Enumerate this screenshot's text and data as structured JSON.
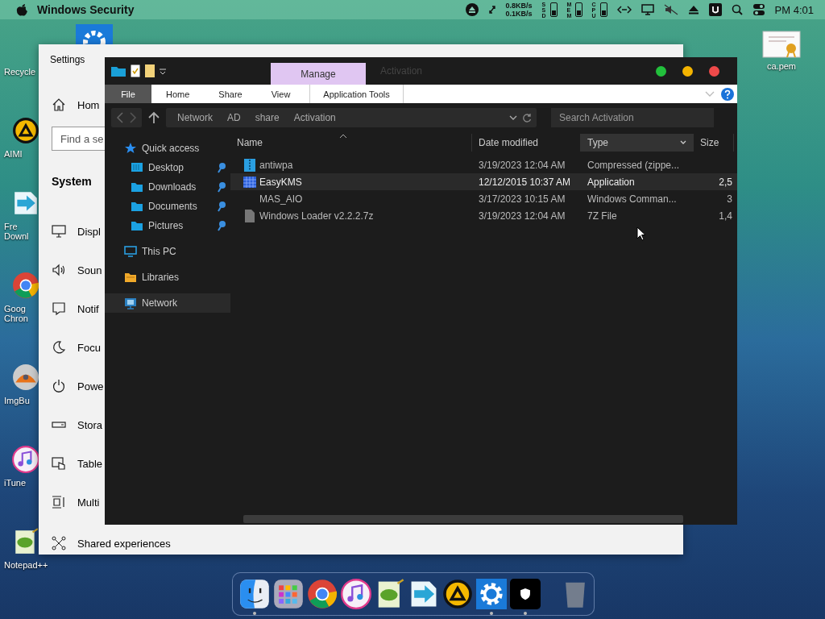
{
  "menu_bar": {
    "app_name": "Windows Security",
    "net_up": "0.8KB/s",
    "net_down": "0.1KB/s",
    "meters": [
      {
        "label": "SSD"
      },
      {
        "label": "MEM"
      },
      {
        "label": "CPU"
      }
    ],
    "clock": "PM 4:01"
  },
  "desktop_icons": [
    {
      "kind": "recycle",
      "lines": [
        "Recycle"
      ]
    },
    {
      "kind": "aimp",
      "lines": [
        "AIMI"
      ]
    },
    {
      "kind": "download",
      "lines": [
        "Fre",
        "Downl"
      ]
    },
    {
      "kind": "chrome",
      "lines": [
        "Goog",
        "Chron"
      ]
    },
    {
      "kind": "disc",
      "lines": [
        "ImgBu"
      ]
    },
    {
      "kind": "music",
      "lines": [
        "iTune"
      ]
    },
    {
      "kind": "notepad",
      "lines": [
        "Notepad++"
      ]
    }
  ],
  "right_icon": {
    "label": "ca.pem"
  },
  "settings": {
    "title": "Settings",
    "home": "Hom",
    "search_placeholder": "Find a se",
    "section": "System",
    "items": [
      {
        "kind": "display",
        "label": "Displ"
      },
      {
        "kind": "sound",
        "label": "Soun"
      },
      {
        "kind": "notify",
        "label": "Notif"
      },
      {
        "kind": "focus",
        "label": "Focu"
      },
      {
        "kind": "power",
        "label": "Powe"
      },
      {
        "kind": "storage",
        "label": "Stora"
      },
      {
        "kind": "tablet",
        "label": "Table"
      },
      {
        "kind": "multi",
        "label": "Multi"
      },
      {
        "kind": "shared",
        "label": "Shared experiences"
      }
    ]
  },
  "explorer": {
    "title": "Activation",
    "context_group": "Manage",
    "ribbon_tabs": [
      {
        "kind": "file",
        "label": "File"
      },
      {
        "kind": "tab",
        "label": "Home"
      },
      {
        "kind": "tab",
        "label": "Share"
      },
      {
        "kind": "tab",
        "label": "View"
      },
      {
        "kind": "context",
        "label": "Application Tools"
      }
    ],
    "breadcrumbs": [
      "Network",
      "AD",
      "share",
      "Activation"
    ],
    "search_placeholder": "Search Activation",
    "nav": [
      {
        "kind": "star",
        "label": "Quick access",
        "pinned": false,
        "selected": false,
        "children": [
          {
            "kind": "desktop",
            "label": "Desktop",
            "pinned": true,
            "selected": false
          },
          {
            "kind": "download",
            "label": "Downloads",
            "pinned": true,
            "selected": false
          },
          {
            "kind": "folder",
            "label": "Documents",
            "pinned": true,
            "selected": false
          },
          {
            "kind": "folder",
            "label": "Pictures",
            "pinned": true,
            "selected": false
          }
        ]
      },
      {
        "kind": "pc",
        "label": "This PC",
        "pinned": false,
        "selected": false
      },
      {
        "kind": "library",
        "label": "Libraries",
        "pinned": false,
        "selected": false
      },
      {
        "kind": "network",
        "label": "Network",
        "pinned": false,
        "selected": true
      }
    ],
    "columns": [
      {
        "label": "Name",
        "sorted": true,
        "highlighted": false
      },
      {
        "label": "Date modified",
        "sorted": false,
        "highlighted": false
      },
      {
        "label": "Type",
        "sorted": false,
        "highlighted": true
      },
      {
        "label": "Size",
        "sorted": false,
        "highlighted": false
      }
    ],
    "rows": [
      {
        "kind": "zip",
        "name": "antiwpa",
        "date": "3/19/2023 12:04 AM",
        "type": "Compressed (zippe...",
        "selected": false
      },
      {
        "kind": "app",
        "name": "EasyKMS",
        "date": "12/12/2015 10:37 AM",
        "type": "Application",
        "size": "2,5",
        "selected": true
      },
      {
        "kind": "none",
        "name": "MAS_AIO",
        "date": "3/17/2023 10:15 AM",
        "type": "Windows Comman...",
        "size": "3",
        "selected": false
      },
      {
        "kind": "file",
        "name": "Windows Loader v2.2.2.7z",
        "date": "3/19/2023 12:04 AM",
        "type": "7Z File",
        "size": "1,4",
        "selected": false
      }
    ]
  },
  "dock": [
    {
      "kind": "finder",
      "running": true
    },
    {
      "kind": "launchpad",
      "running": false
    },
    {
      "kind": "chrome",
      "running": false
    },
    {
      "kind": "music",
      "running": false
    },
    {
      "kind": "notepad",
      "running": false
    },
    {
      "kind": "download",
      "running": false
    },
    {
      "kind": "aimp",
      "running": false
    },
    {
      "kind": "gear",
      "running": true
    },
    {
      "kind": "shield",
      "running": true
    },
    {
      "kind": "trash",
      "running": false
    }
  ]
}
